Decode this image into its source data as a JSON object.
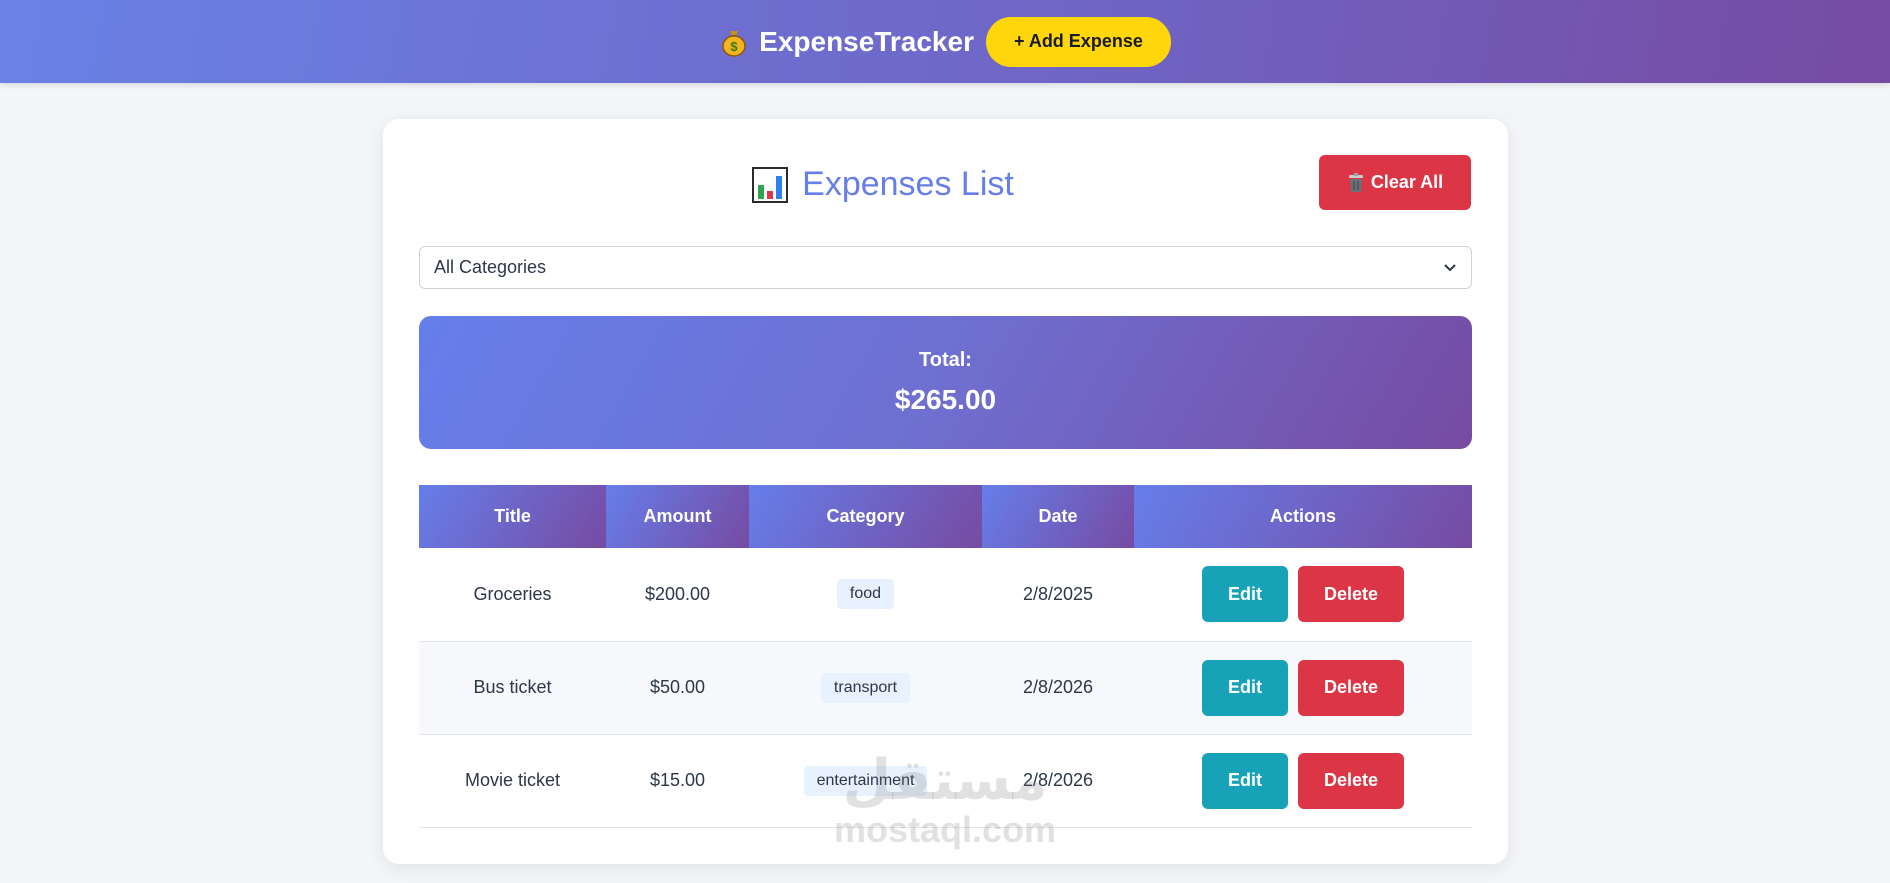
{
  "navbar": {
    "brand": "ExpenseTracker",
    "brand_icon": "money-bag-icon",
    "add_button": "+ Add Expense"
  },
  "card": {
    "title": "Expenses List",
    "title_icon": "bar-chart-icon",
    "clear_button": "Clear All",
    "clear_icon": "trash-icon",
    "filter": {
      "selected": "All Categories"
    },
    "total": {
      "label": "Total:",
      "value": "$265.00"
    },
    "table": {
      "headers": [
        "Title",
        "Amount",
        "Category",
        "Date",
        "Actions"
      ],
      "rows": [
        {
          "title": "Groceries",
          "amount": "$200.00",
          "category": "food",
          "date": "2/8/2025",
          "edit": "Edit",
          "delete": "Delete"
        },
        {
          "title": "Bus ticket",
          "amount": "$50.00",
          "category": "transport",
          "date": "2/8/2026",
          "edit": "Edit",
          "delete": "Delete"
        },
        {
          "title": "Movie ticket",
          "amount": "$15.00",
          "category": "entertainment",
          "date": "2/8/2026",
          "edit": "Edit",
          "delete": "Delete"
        }
      ]
    }
  },
  "watermark": {
    "arabic": "مستقل",
    "latin": "mostaql.com"
  },
  "colors": {
    "accent": "#667eea",
    "accent_dark": "#764ba2",
    "add_button": "#ffd60a",
    "danger": "#dc3545",
    "info": "#17a2b8"
  }
}
